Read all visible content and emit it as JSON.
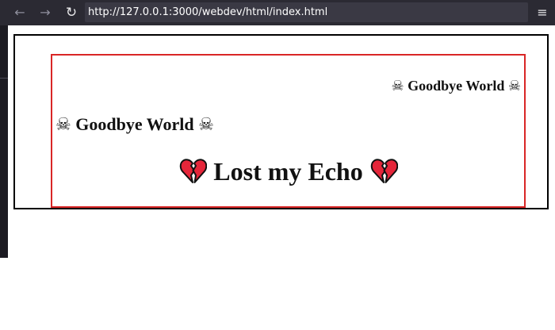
{
  "browser": {
    "back_icon": "←",
    "forward_icon": "→",
    "reload_icon": "↻",
    "url": "http://127.0.0.1:3000/webdev/html/index.html",
    "menu_icon": "≡"
  },
  "page": {
    "heading_right": {
      "icon": "☠",
      "text": "Goodbye World"
    },
    "heading_left": {
      "icon": "☠",
      "text": "Goodbye World"
    },
    "heading_center": {
      "icon": "broken-heart-icon",
      "text": "Lost my Echo"
    }
  },
  "colors": {
    "toolbar_bg": "#2b2a33",
    "urlbar_bg": "#3a3944",
    "inner_border": "#d92626",
    "outer_border": "#000000",
    "heart": "#e5263a"
  }
}
